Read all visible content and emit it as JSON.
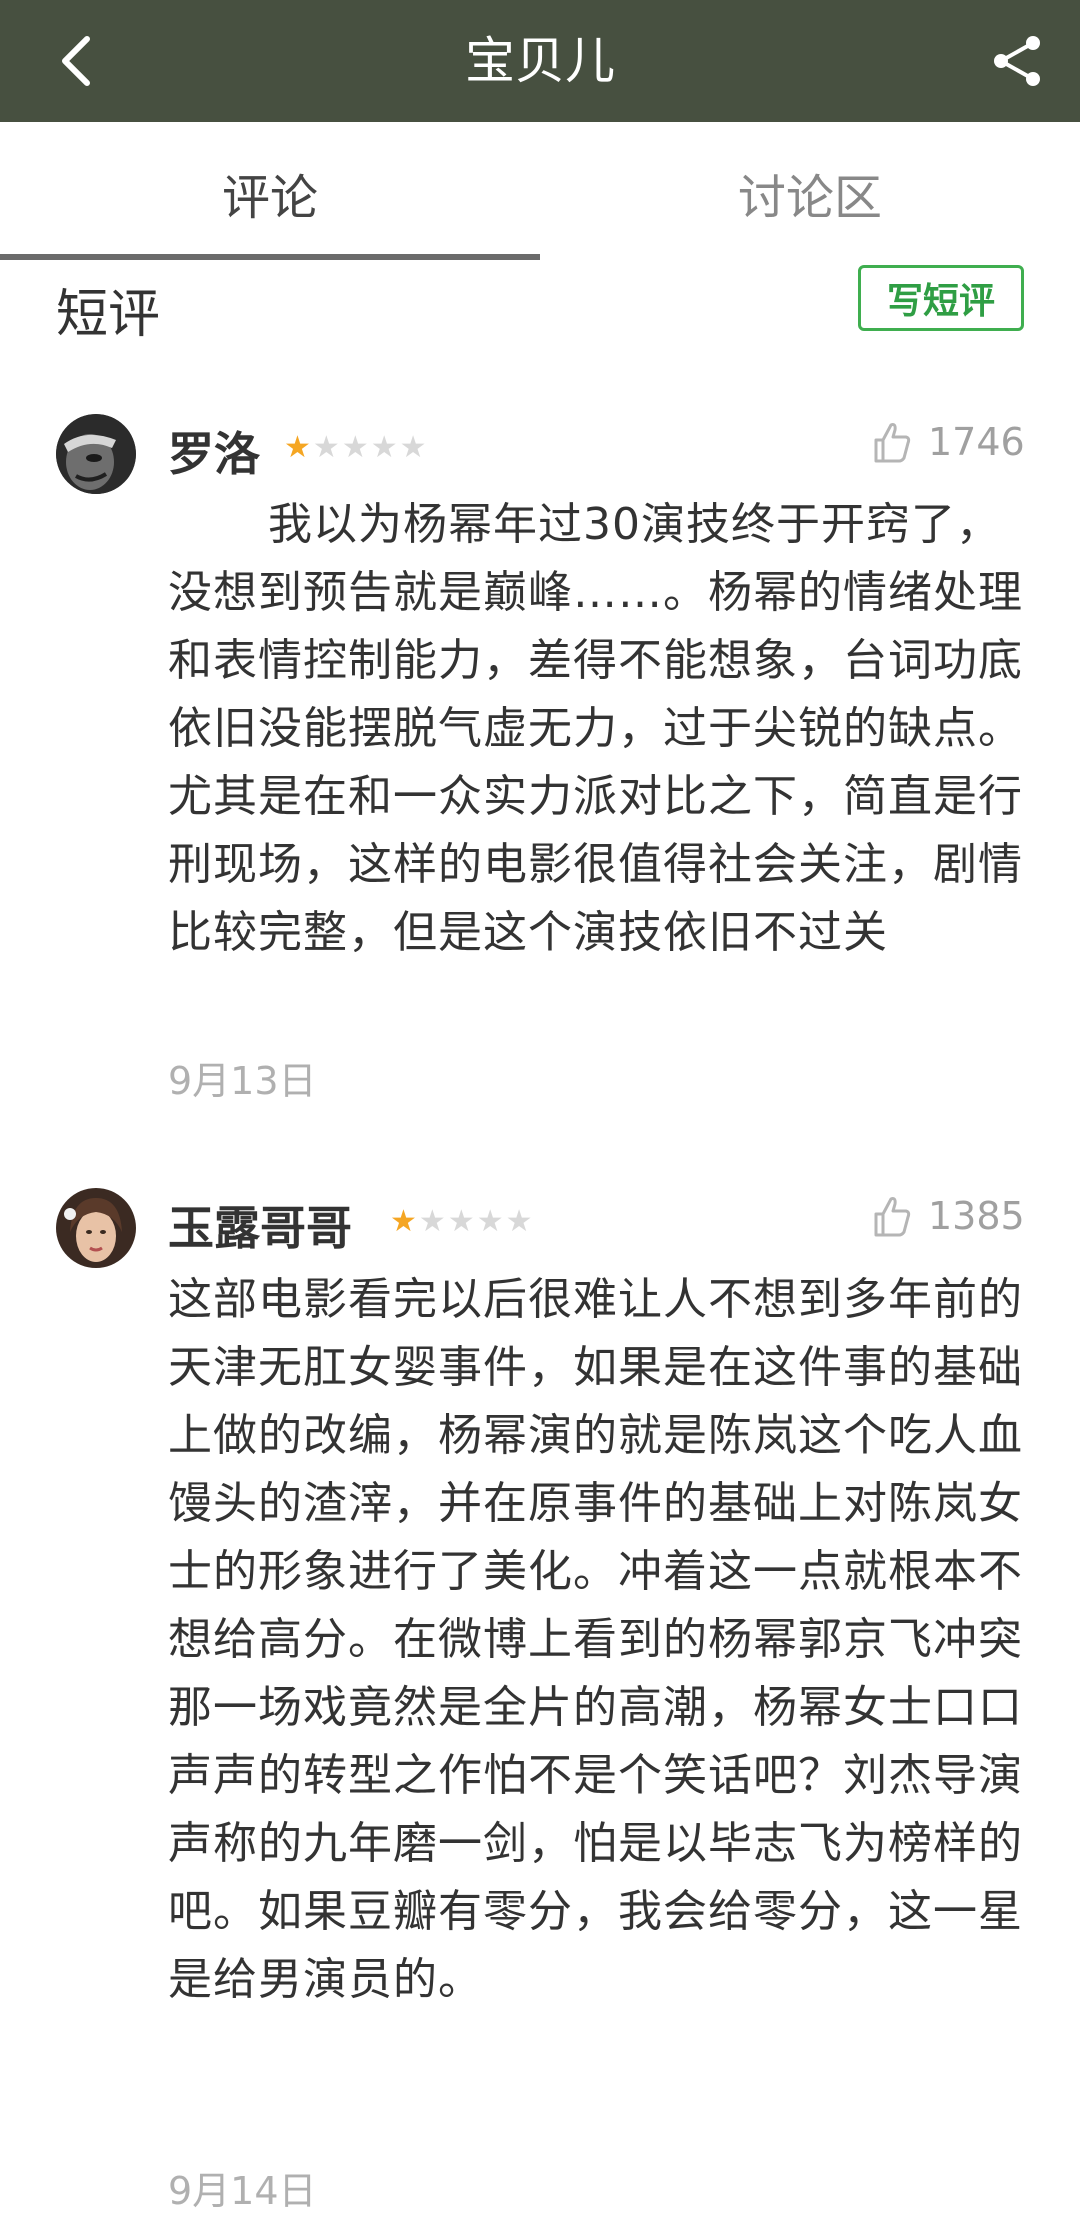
{
  "header": {
    "title": "宝贝儿",
    "back_icon": "back-arrow-icon",
    "share_icon": "share-icon",
    "bg_color": "#475040"
  },
  "tabs": [
    {
      "label": "评论",
      "active": true
    },
    {
      "label": "讨论区",
      "active": false
    }
  ],
  "section": {
    "title": "短评",
    "write_button": "写短评"
  },
  "reviews": [
    {
      "username": "罗洛",
      "rating": 1,
      "max_rating": 5,
      "likes": "1746",
      "content": "我以为杨幂年过30演技终于开窍了，没想到预告就是巅峰……。杨幂的情绪处理和表情控制能力，差得不能想象，台词功底依旧没能摆脱气虚无力，过于尖锐的缺点。尤其是在和一众实力派对比之下，简直是行刑现场，这样的电影很值得社会关注，剧情比较完整，但是这个演技依旧不过关",
      "date": "9月13日"
    },
    {
      "username": "玉露哥哥",
      "rating": 1,
      "max_rating": 5,
      "likes": "1385",
      "content": "这部电影看完以后很难让人不想到多年前的天津无肛女婴事件，如果是在这件事的基础上做的改编，杨幂演的就是陈岚这个吃人血馒头的渣滓，并在原事件的基础上对陈岚女士的形象进行了美化。冲着这一点就根本不想给高分。在微博上看到的杨幂郭京飞冲突那一场戏竟然是全片的高潮，杨幂女士口口声声的转型之作怕不是个笑话吧？刘杰导演声称的九年磨一剑，怕是以毕志飞为榜样的吧。如果豆瓣有零分，我会给零分，这一星是给男演员的。",
      "date": "9月14日"
    }
  ]
}
